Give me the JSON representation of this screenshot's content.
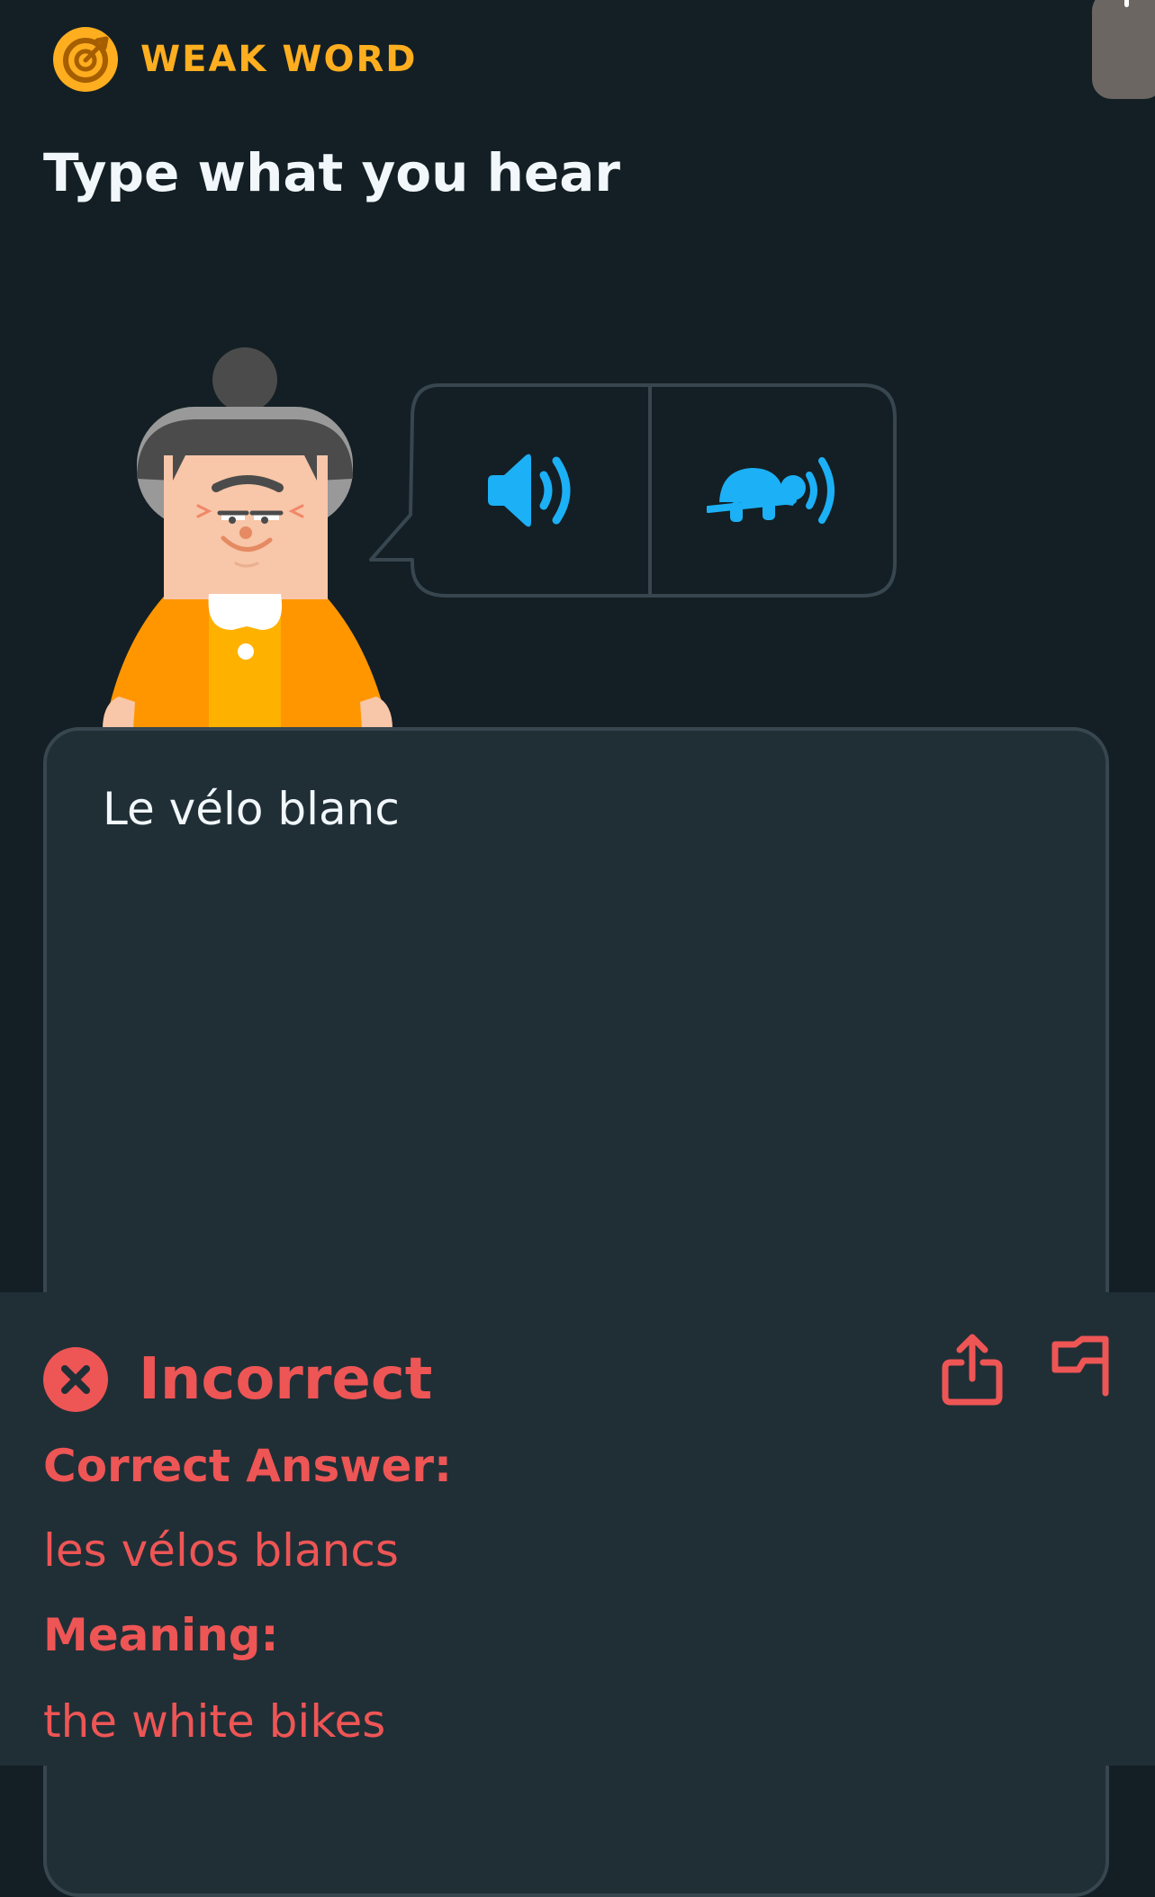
{
  "header": {
    "badge_label": "WEAK WORD",
    "badge_icon": "target-icon",
    "prompt": "Type what you hear"
  },
  "audio": {
    "normal_icon": "speaker-icon",
    "slow_icon": "turtle-speaker-icon"
  },
  "answer": {
    "typed_text": "Le vélo blanc"
  },
  "feedback": {
    "status": "Incorrect",
    "status_icon": "x-circle-icon",
    "correct_answer_label": "Correct Answer:",
    "correct_answer": "les vélos blancs",
    "meaning_label": "Meaning:",
    "meaning": "the white bikes",
    "share_icon": "share-icon",
    "report_icon": "flag-icon"
  },
  "colors": {
    "background": "#131f24",
    "panel": "#202f36",
    "border": "#37464f",
    "accent_orange": "#ffae1f",
    "accent_blue": "#1cb0f6",
    "error_red": "#ee5555",
    "text": "#f1f7fb"
  }
}
